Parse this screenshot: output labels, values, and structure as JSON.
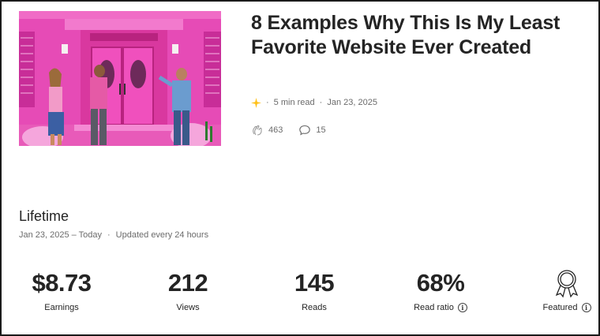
{
  "article": {
    "title": "8 Examples Why This Is My Least Favorite Website Ever Created",
    "read_time": "5 min read",
    "date": "Jan 23, 2025",
    "claps": "463",
    "responses": "15",
    "image_alt": "Three people in front of a pink house"
  },
  "lifetime": {
    "heading": "Lifetime",
    "range": "Jan 23, 2025 – Today",
    "update_note": "Updated every 24 hours"
  },
  "stats": [
    {
      "value": "$8.73",
      "label": "Earnings"
    },
    {
      "value": "212",
      "label": "Views"
    },
    {
      "value": "145",
      "label": "Reads"
    },
    {
      "value": "68%",
      "label": "Read ratio"
    }
  ],
  "featured": {
    "label": "Featured"
  },
  "icons": {
    "member_star": "star-icon",
    "claps": "clap-icon",
    "responses": "comment-icon",
    "info": "info-icon",
    "featured": "award-ribbon-icon"
  },
  "colors": {
    "accent_star": "#ffc017",
    "text_primary": "#242424",
    "text_secondary": "#6b6b6b",
    "house_pink": "#e83fb4"
  }
}
